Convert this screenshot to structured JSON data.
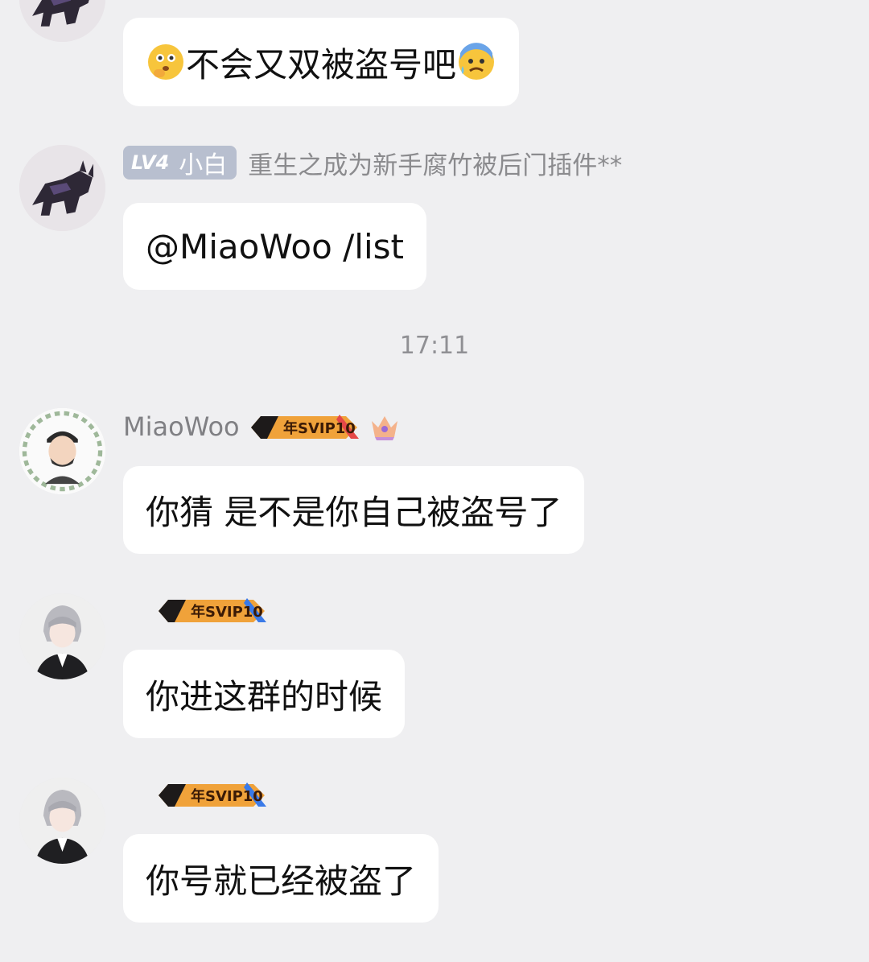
{
  "messages": [
    {
      "avatar_icon": "wolf-avatar-icon",
      "text": "不会又双被盗号吧",
      "emoji_before": "thinking-face-emoji",
      "emoji_after": "anxious-face-emoji"
    },
    {
      "avatar_icon": "wolf-avatar-icon",
      "level_badge": {
        "level": "LV4",
        "title": "小白"
      },
      "group_title": "重生之成为新手腐竹被后门插件**",
      "text": "@MiaoWoo /list"
    },
    {
      "avatar_icon": "man-avatar-icon",
      "nickname": "MiaoWoo",
      "badge": "年SVIP10",
      "crown_icon": "crown-icon",
      "text": "你猜 是不是你自己被盗号了"
    },
    {
      "avatar_icon": "anime-avatar-icon",
      "badge": "年SVIP10",
      "text": "你进这群的时候"
    },
    {
      "avatar_icon": "anime-avatar-icon",
      "badge": "年SVIP10",
      "text": "你号就已经被盗了"
    }
  ],
  "timestamp": "17:11",
  "colors": {
    "background": "#efeff1",
    "bubble": "#ffffff",
    "level_badge": "#b8bfcf",
    "meta_text": "#8b8b8e"
  }
}
